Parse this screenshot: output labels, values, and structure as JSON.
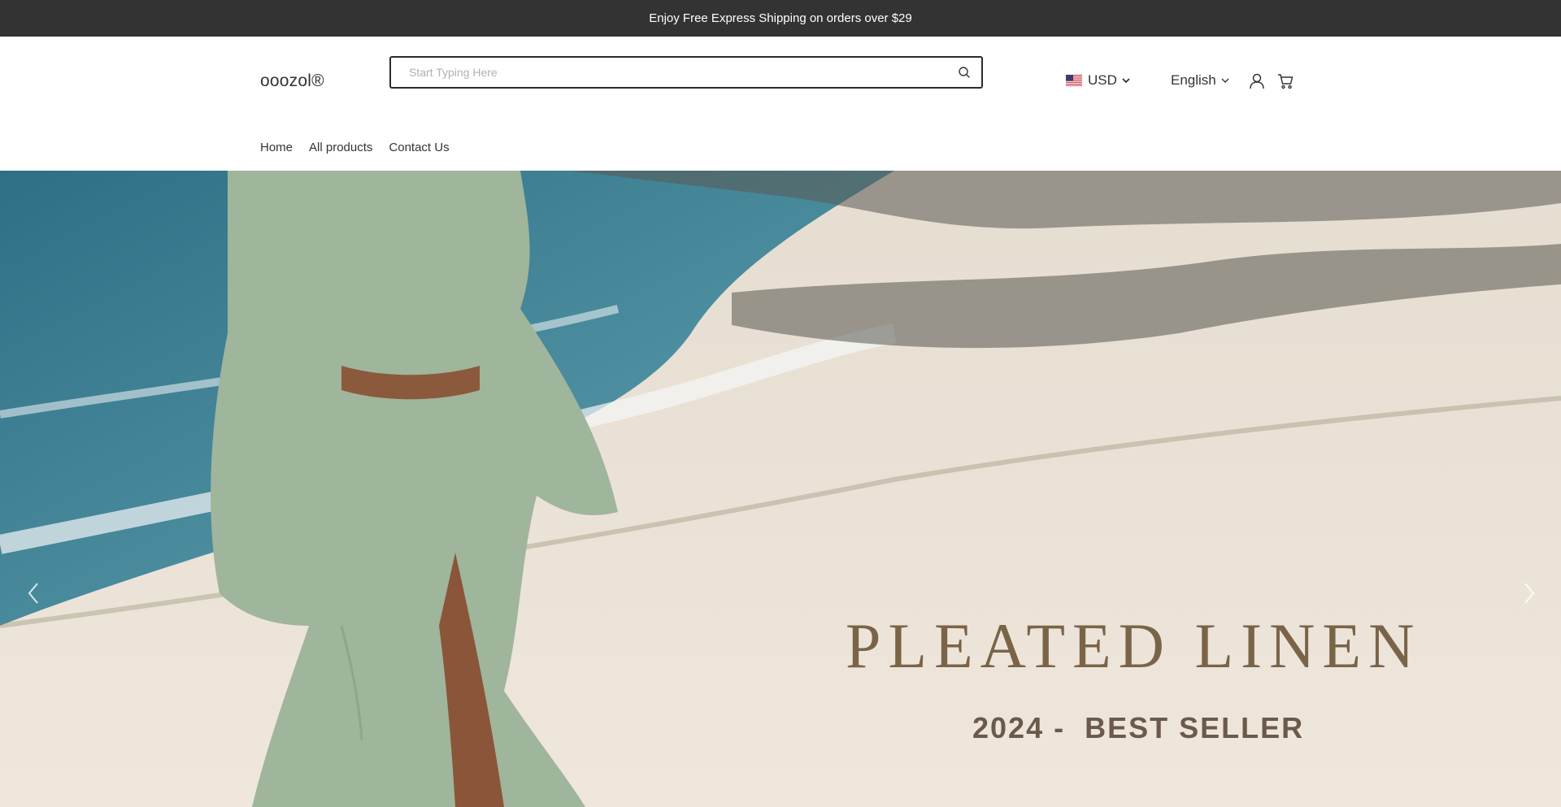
{
  "announcement": {
    "text": "Enjoy Free Express Shipping on orders over $29"
  },
  "header": {
    "logo": "ooozol®",
    "search": {
      "placeholder": "Start Typing Here",
      "value": "",
      "icon": "search-icon"
    },
    "currency": {
      "label": "USD",
      "flag": "us-flag-icon"
    },
    "language": {
      "label": "English"
    },
    "account_icon": "user-icon",
    "cart_icon": "cart-icon"
  },
  "nav": {
    "items": [
      "Home",
      "All products",
      "Contact Us"
    ]
  },
  "hero": {
    "title": "PLEATED LINEN",
    "subtitle": "2024 -  BEST SELLER",
    "colors": {
      "title": "#7a6448",
      "subtitle": "#6b5a4b",
      "sea": "#3f7f94",
      "sand": "#ece4da",
      "garment": "#9db39a"
    }
  },
  "colors": {
    "announcement_bg": "#333333",
    "text": "#333333"
  }
}
